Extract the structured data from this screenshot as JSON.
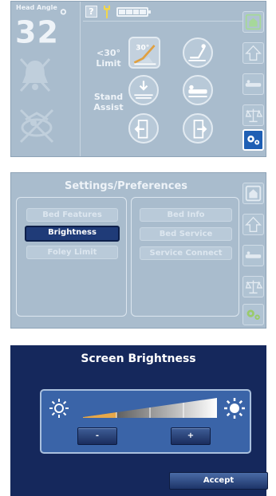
{
  "screen1": {
    "head_angle_label": "Head Angle",
    "head_angle_value": "32",
    "head_angle_unit": "°",
    "help_label": "?",
    "limit_label_line1": "<30°",
    "limit_label_line2": "Limit",
    "limit_icon_text": "30°",
    "stand_label_line1": "Stand",
    "stand_label_line2": "Assist",
    "battery_bars": 4
  },
  "screen2": {
    "title": "Settings/Preferences",
    "left_buttons": [
      "Bed Features",
      "Brightness",
      "Foley Limit"
    ],
    "right_buttons": [
      "Bed Info",
      "Bed Service",
      "Service Connect"
    ],
    "active_button": "Brightness"
  },
  "screen3": {
    "title": "Screen Brightness",
    "decrease_label": "-",
    "increase_label": "+",
    "accept_label": "Accept",
    "brightness_level_fraction": 0.25
  },
  "colors": {
    "dim_background": "#a9bccd",
    "dark_navy": "#15285c",
    "active_button": "#1f3b78",
    "panel_blue": "#3a64a8",
    "selected_sidebar": "#1f5fb4",
    "settings_green": "#9acb6a"
  }
}
